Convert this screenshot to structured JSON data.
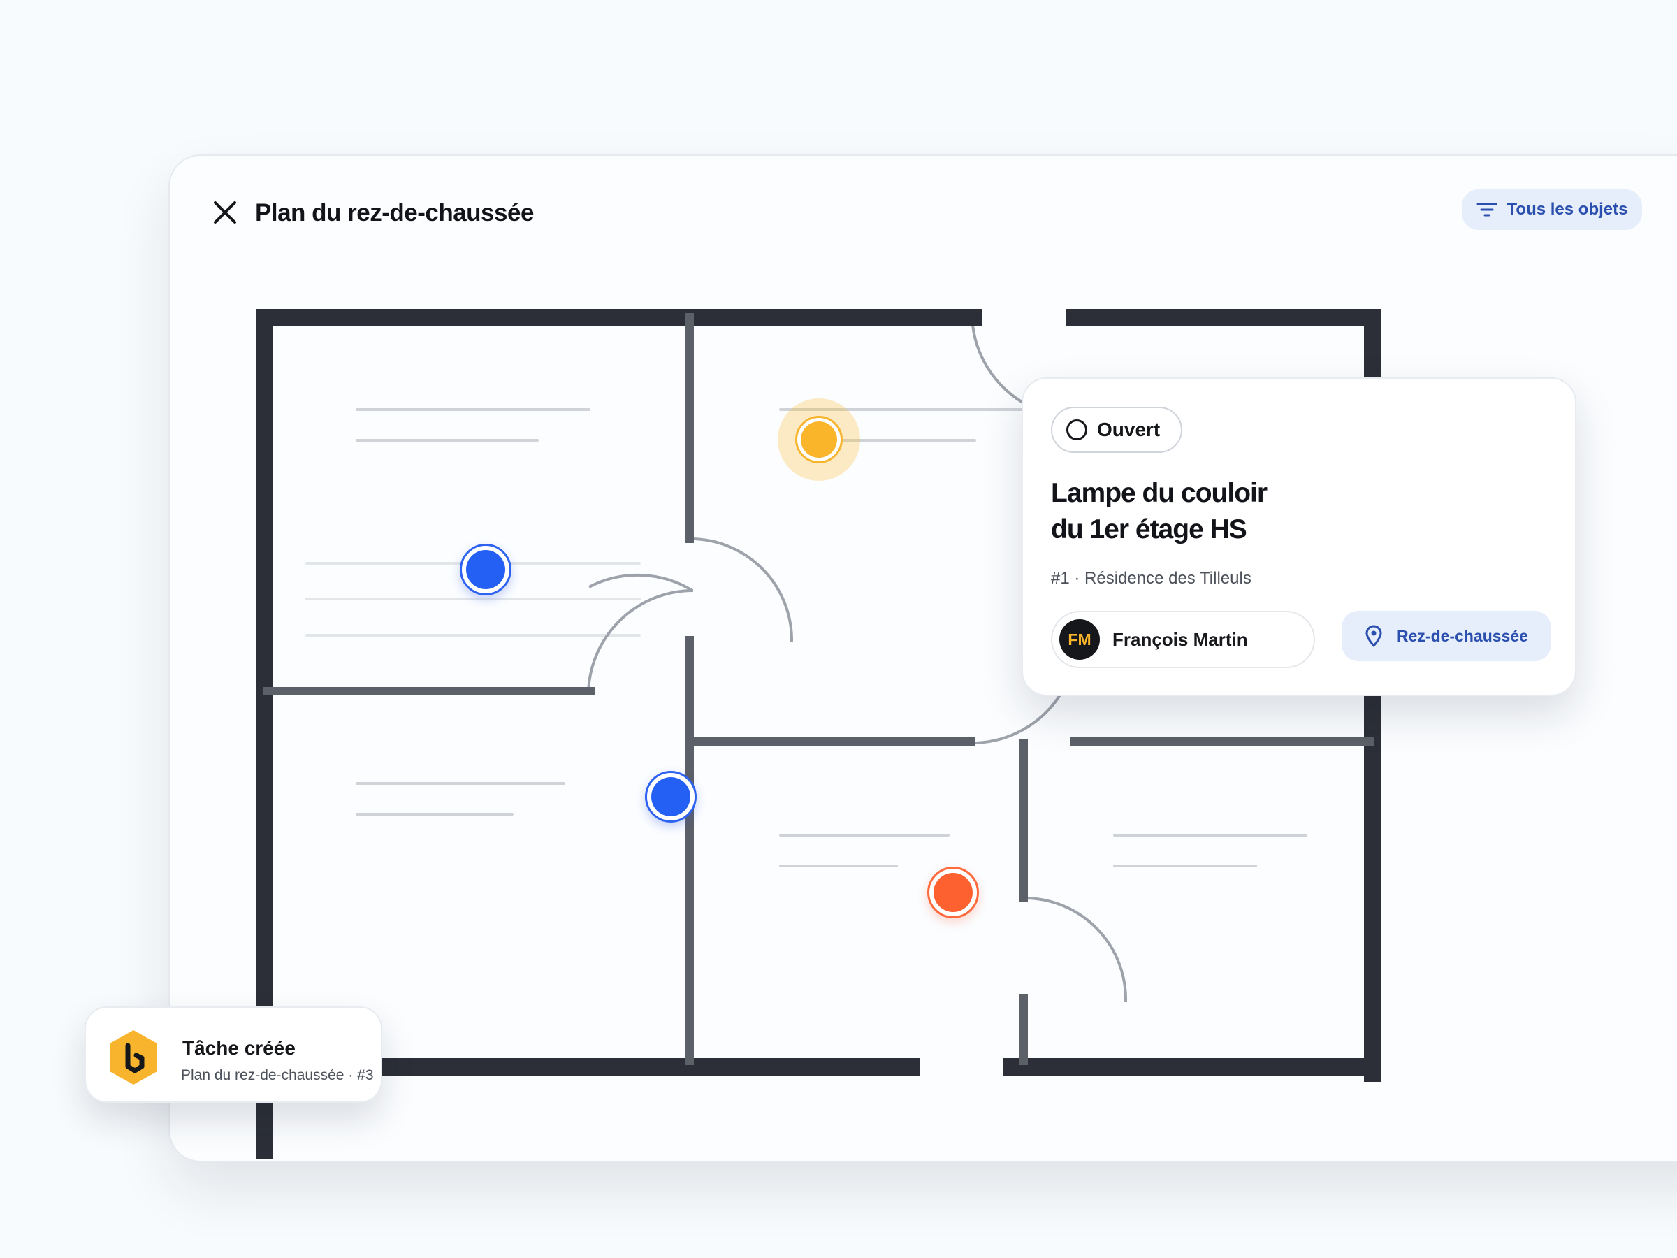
{
  "header": {
    "title": "Plan du rez-de-chaussée",
    "filter_label": "Tous les objets"
  },
  "task_card": {
    "status": "Ouvert",
    "title_line1": "Lampe du couloir",
    "title_line2": "du 1er étage HS",
    "subtitle": "#1 · Résidence des Tilleuls",
    "assignee_initials": "FM",
    "assignee_name": "François Martin",
    "location": "Rez-de-chaussée"
  },
  "toast": {
    "title": "Tâche créée",
    "subtitle": "Plan du rez-de-chaussée · #3"
  },
  "markers": [
    {
      "name": "marker-blue-1",
      "color": "blue"
    },
    {
      "name": "marker-yellow",
      "color": "yellow"
    },
    {
      "name": "marker-blue-2",
      "color": "blue"
    },
    {
      "name": "marker-orange",
      "color": "orange"
    }
  ],
  "colors": {
    "accent_blue": "#2560f5",
    "warning_yellow": "#fbb52b",
    "alert_orange": "#fd6130",
    "wall": "#2c2f37",
    "chip_bg": "#e6eefb",
    "chip_text": "#2a4fae"
  },
  "icons": {
    "close": "close-icon",
    "filter": "filter-icon",
    "status": "circle-icon",
    "location": "map-pin-icon",
    "logo": "hexagon-logo-icon"
  }
}
